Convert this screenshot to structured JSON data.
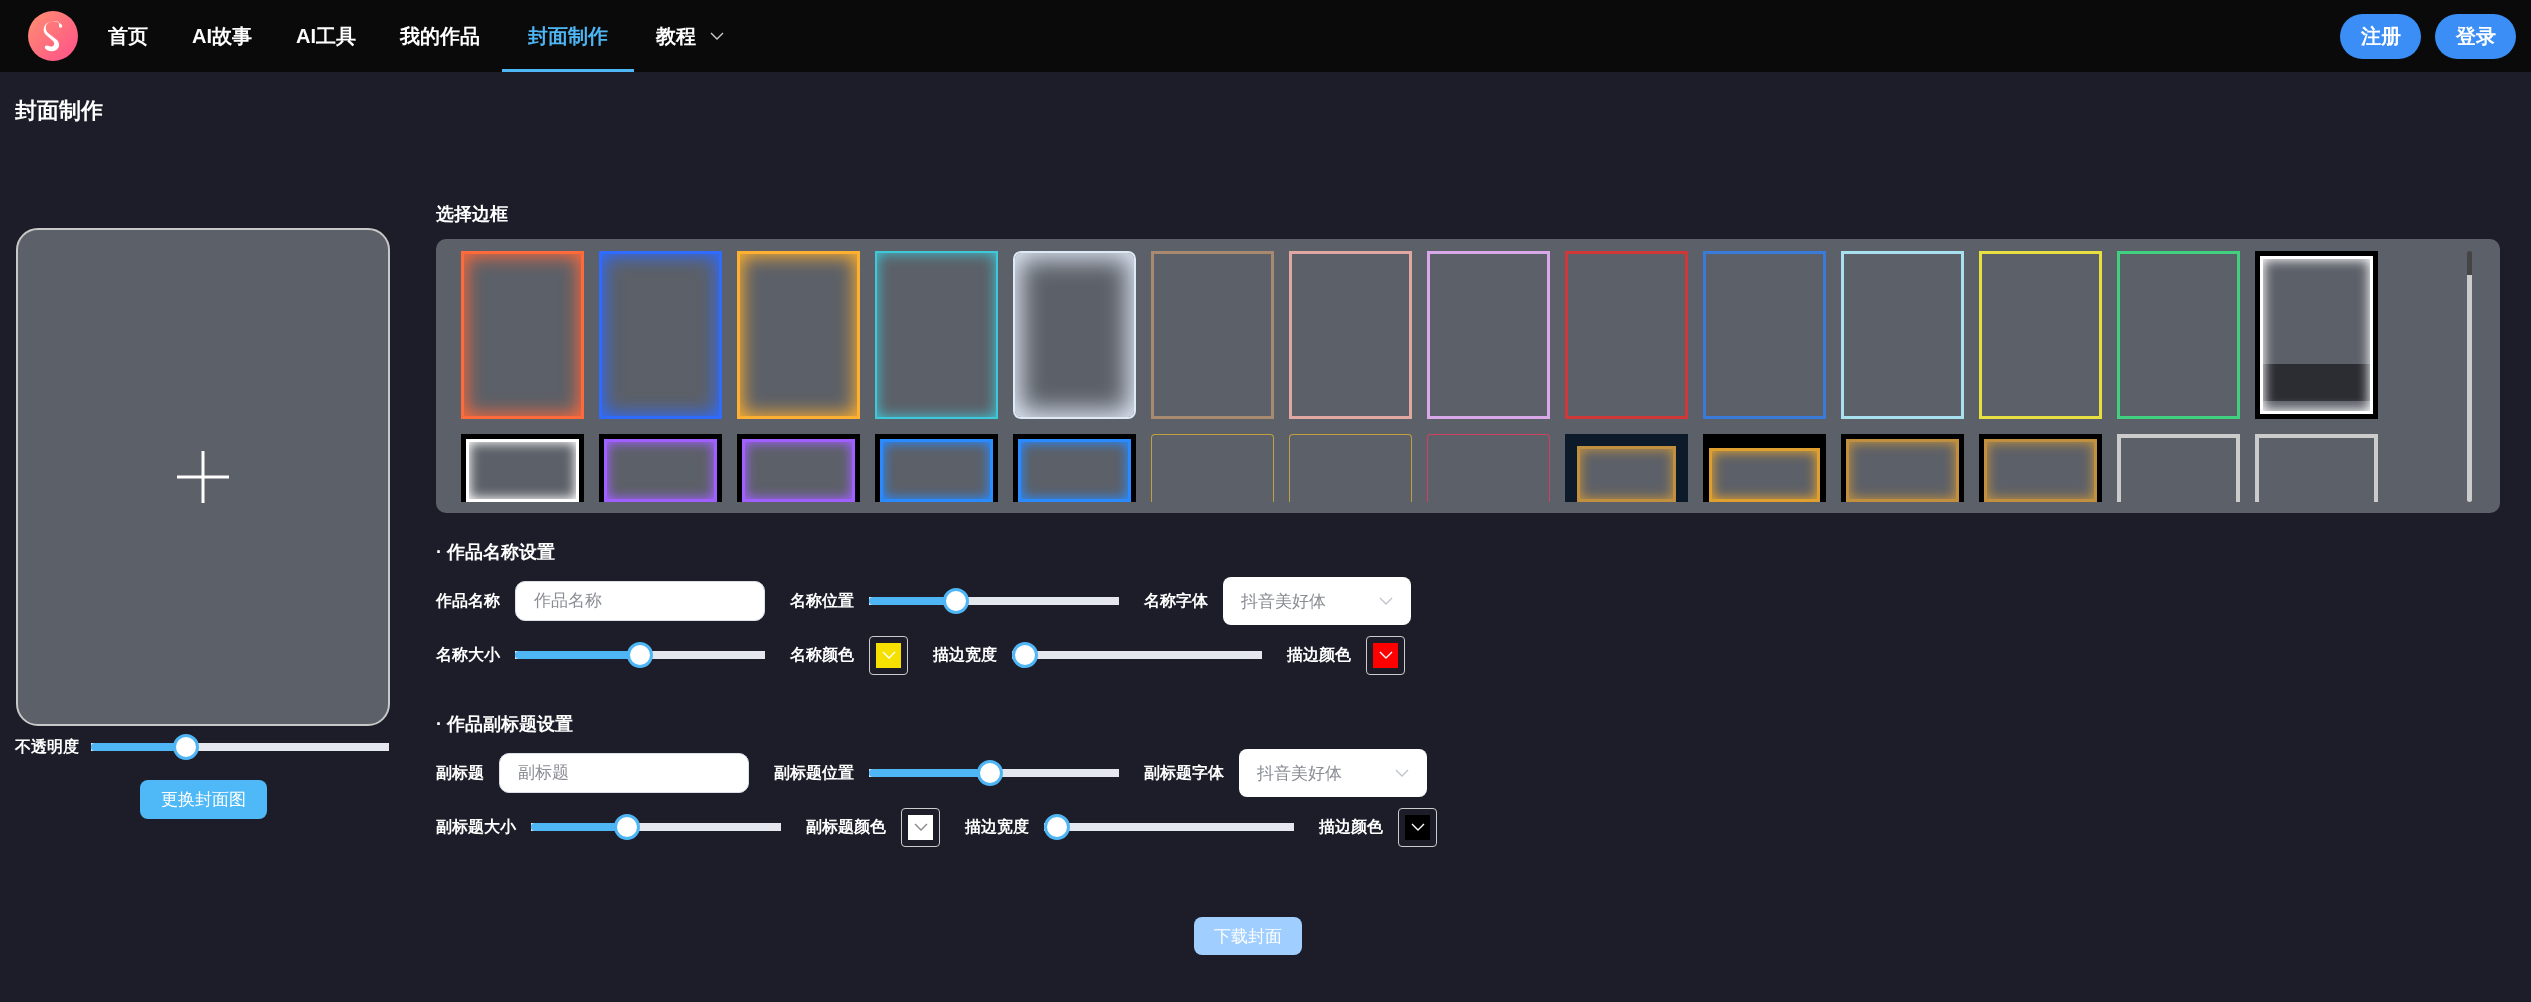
{
  "nav": {
    "items": [
      {
        "label": "首页",
        "selected": false,
        "dropdown": false
      },
      {
        "label": "AI故事",
        "selected": false,
        "dropdown": false
      },
      {
        "label": "AI工具",
        "selected": false,
        "dropdown": false
      },
      {
        "label": "我的作品",
        "selected": false,
        "dropdown": false
      },
      {
        "label": "封面制作",
        "selected": true,
        "dropdown": false
      },
      {
        "label": "教程",
        "selected": false,
        "dropdown": true
      }
    ],
    "buttons": [
      "注册",
      "登录"
    ]
  },
  "page_title": "封面制作",
  "cover": {
    "opacity_label": "不透明度",
    "opacity": {
      "level": 0.3
    },
    "button": "更换封面图"
  },
  "frames": {
    "title": "选择边框",
    "rows": [
      [
        {
          "kind": "flame",
          "color": "#ff6a3a"
        },
        {
          "kind": "flame",
          "color": "#2f6bff"
        },
        {
          "kind": "flame",
          "color": "#ffb030"
        },
        {
          "kind": "bracket",
          "color": "#3ec8d8"
        },
        {
          "kind": "mist",
          "color": "#dfe8f5"
        },
        {
          "kind": "line",
          "color": "#a88a70"
        },
        {
          "kind": "line",
          "color": "#e0a8a0"
        },
        {
          "kind": "line",
          "color": "#d8a8e8"
        },
        {
          "kind": "line",
          "color": "#d03838"
        },
        {
          "kind": "line",
          "color": "#3a7ad8"
        },
        {
          "kind": "line",
          "color": "#a8e0f0"
        },
        {
          "kind": "line",
          "color": "#e8e040"
        },
        {
          "kind": "line",
          "color": "#40d080"
        },
        {
          "kind": "glitch",
          "color": "#ffffff"
        }
      ],
      [
        {
          "kind": "glitch",
          "color": "#ffffff"
        },
        {
          "kind": "neon",
          "color": "#a060ff"
        },
        {
          "kind": "neon",
          "color": "#a060ff"
        },
        {
          "kind": "glow",
          "color": "#2a8aff"
        },
        {
          "kind": "glow",
          "color": "#2a8aff"
        },
        {
          "kind": "thin",
          "color": "#c0a040"
        },
        {
          "kind": "thin",
          "color": "#c0a040"
        },
        {
          "kind": "thin",
          "color": "#d04060"
        },
        {
          "kind": "navy",
          "color": "#c09040"
        },
        {
          "kind": "ornate",
          "color": "#e0a030"
        },
        {
          "kind": "rounded",
          "color": "#c09040"
        },
        {
          "kind": "rounded",
          "color": "#c09040"
        },
        {
          "kind": "silver",
          "color": "#cccccc"
        },
        {
          "kind": "silver",
          "color": "#cccccc"
        }
      ]
    ]
  },
  "sections": [
    {
      "title": "· 作品名称设置",
      "rows": [
        [
          {
            "kind": "text",
            "label": "作品名称",
            "placeholder": "作品名称"
          },
          {
            "kind": "slider",
            "label": "名称位置",
            "level": 0.33
          },
          {
            "kind": "select",
            "label": "名称字体",
            "value": "抖音美好体"
          }
        ],
        [
          {
            "kind": "slider",
            "label": "名称大小",
            "level": 0.5
          },
          {
            "kind": "color",
            "label": "名称颜色",
            "color": "#f5e000"
          },
          {
            "kind": "slider",
            "label": "描边宽度",
            "level": 0
          },
          {
            "kind": "color",
            "label": "描边颜色",
            "color": "#ff0000"
          }
        ]
      ]
    },
    {
      "title": "· 作品副标题设置",
      "rows": [
        [
          {
            "kind": "text",
            "label": "副标题",
            "placeholder": "副标题"
          },
          {
            "kind": "slider",
            "label": "副标题位置",
            "level": 0.48
          },
          {
            "kind": "select",
            "label": "副标题字体",
            "value": "抖音美好体"
          }
        ],
        [
          {
            "kind": "slider",
            "label": "副标题大小",
            "level": 0.37
          },
          {
            "kind": "color",
            "label": "副标题颜色",
            "color": "#ffffff"
          },
          {
            "kind": "slider",
            "label": "描边宽度",
            "level": 0
          },
          {
            "kind": "color",
            "label": "描边颜色",
            "color": "#000000"
          }
        ]
      ]
    }
  ],
  "download_button": "下载封面"
}
